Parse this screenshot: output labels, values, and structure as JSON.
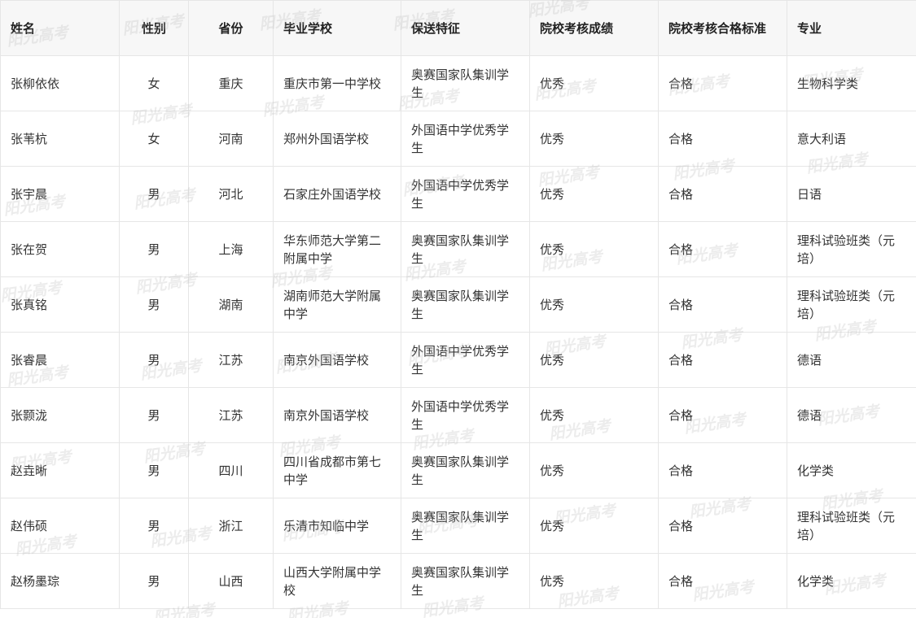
{
  "table": {
    "headers": [
      "姓名",
      "性别",
      "省份",
      "毕业学校",
      "保送特征",
      "院校考核成绩",
      "院校考核合格标准",
      "专业"
    ],
    "rows": [
      [
        "张柳依依",
        "女",
        "重庆",
        "重庆市第一中学校",
        "奥赛国家队集训学生",
        "优秀",
        "合格",
        "生物科学类"
      ],
      [
        "张苇杭",
        "女",
        "河南",
        "郑州外国语学校",
        "外国语中学优秀学生",
        "优秀",
        "合格",
        "意大利语"
      ],
      [
        "张宇晨",
        "男",
        "河北",
        "石家庄外国语学校",
        "外国语中学优秀学生",
        "优秀",
        "合格",
        "日语"
      ],
      [
        "张在贺",
        "男",
        "上海",
        "华东师范大学第二附属中学",
        "奥赛国家队集训学生",
        "优秀",
        "合格",
        "理科试验班类（元培）"
      ],
      [
        "张真铭",
        "男",
        "湖南",
        "湖南师范大学附属中学",
        "奥赛国家队集训学生",
        "优秀",
        "合格",
        "理科试验班类（元培）"
      ],
      [
        "张睿晨",
        "男",
        "江苏",
        "南京外国语学校",
        "外国语中学优秀学生",
        "优秀",
        "合格",
        "德语"
      ],
      [
        "张颢泷",
        "男",
        "江苏",
        "南京外国语学校",
        "外国语中学优秀学生",
        "优秀",
        "合格",
        "德语"
      ],
      [
        "赵垚晰",
        "男",
        "四川",
        "四川省成都市第七中学",
        "奥赛国家队集训学生",
        "优秀",
        "合格",
        "化学类"
      ],
      [
        "赵伟硕",
        "男",
        "浙江",
        "乐清市知临中学",
        "奥赛国家队集训学生",
        "优秀",
        "合格",
        "理科试验班类（元培）"
      ],
      [
        "赵杨墨琮",
        "男",
        "山西",
        "山西大学附属中学校",
        "奥赛国家队集训学生",
        "优秀",
        "合格",
        "化学类"
      ]
    ]
  },
  "watermark": {
    "text": "阳光高考"
  }
}
